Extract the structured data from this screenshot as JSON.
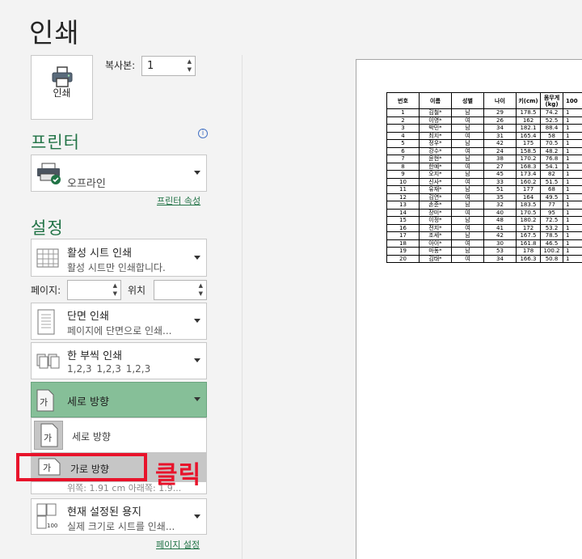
{
  "title": "인쇄",
  "print_button": {
    "label": "인쇄",
    "icon": "printer-icon"
  },
  "copies": {
    "label": "복사본:",
    "value": "1"
  },
  "printer": {
    "section_title": "프린터",
    "status": "오프라인",
    "properties_link": "프린터 속성",
    "icon": "printer-offline-icon"
  },
  "settings": {
    "section_title": "설정",
    "print_what": {
      "title": "활성 시트 인쇄",
      "subtitle": "활성 시트만 인쇄합니다."
    },
    "pages_label": "페이지:",
    "pages_to_label": "위치",
    "sides": {
      "title": "단면 인쇄",
      "subtitle": "페이지에 단면으로 인쇄..."
    },
    "collate": {
      "title": "한 부씩 인쇄",
      "subtitle": "1,2,3    1,2,3    1,2,3"
    },
    "orientation": {
      "title": "세로 방향"
    },
    "orientation_menu": [
      {
        "label": "세로 방향",
        "icon": "portrait-icon"
      },
      {
        "label": "가로 방향",
        "icon": "landscape-icon"
      }
    ],
    "margins_partial": "위쪽: 1.91 cm 아래쪽: 1.9...",
    "paper": {
      "title": "현재 설정된 용지",
      "subtitle": "실제 크기로 시트를 인쇄..."
    },
    "page_setup_link": "페이지 설정"
  },
  "annotation": {
    "label": "클릭",
    "color": "#e8132b"
  },
  "colors": {
    "accent": "#217346",
    "selected": "#86bf98"
  },
  "preview_table": {
    "headers": [
      "번호",
      "이름",
      "성별",
      "나이",
      "키(cm)",
      "몸무게\n(kg)",
      "100"
    ],
    "rows": [
      [
        "1",
        "김철*",
        "남",
        "29",
        "178.5",
        "74.2",
        "1"
      ],
      [
        "2",
        "이영*",
        "여",
        "26",
        "162",
        "52.5",
        "1"
      ],
      [
        "3",
        "박민*",
        "남",
        "34",
        "182.1",
        "88.4",
        "1"
      ],
      [
        "4",
        "최지*",
        "여",
        "31",
        "165.4",
        "58",
        "1"
      ],
      [
        "5",
        "정우*",
        "남",
        "42",
        "175",
        "70.5",
        "1"
      ],
      [
        "6",
        "강수*",
        "여",
        "24",
        "158.5",
        "48.2",
        "1"
      ],
      [
        "7",
        "윤현*",
        "남",
        "38",
        "170.2",
        "76.8",
        "1"
      ],
      [
        "8",
        "한예*",
        "여",
        "27",
        "168.3",
        "54.1",
        "1"
      ],
      [
        "9",
        "오지*",
        "남",
        "45",
        "173.4",
        "82",
        "1"
      ],
      [
        "10",
        "신사*",
        "여",
        "33",
        "160.2",
        "51.5",
        "1"
      ],
      [
        "11",
        "유재*",
        "남",
        "51",
        "177",
        "68",
        "1"
      ],
      [
        "12",
        "김연*",
        "여",
        "35",
        "164",
        "49.5",
        "1"
      ],
      [
        "13",
        "손준*",
        "남",
        "32",
        "183.5",
        "77",
        "1"
      ],
      [
        "14",
        "장미*",
        "여",
        "40",
        "170.5",
        "95",
        "1"
      ],
      [
        "15",
        "이정*",
        "남",
        "48",
        "180.2",
        "72.5",
        "1"
      ],
      [
        "16",
        "전지*",
        "여",
        "41",
        "172",
        "53.2",
        "1"
      ],
      [
        "17",
        "조세*",
        "남",
        "42",
        "167.5",
        "78.5",
        "1"
      ],
      [
        "18",
        "아이*",
        "여",
        "30",
        "161.8",
        "46.5",
        "1"
      ],
      [
        "19",
        "마동*",
        "남",
        "53",
        "178",
        "100.2",
        "1"
      ],
      [
        "20",
        "김태*",
        "여",
        "34",
        "166.3",
        "50.8",
        "1"
      ]
    ]
  }
}
